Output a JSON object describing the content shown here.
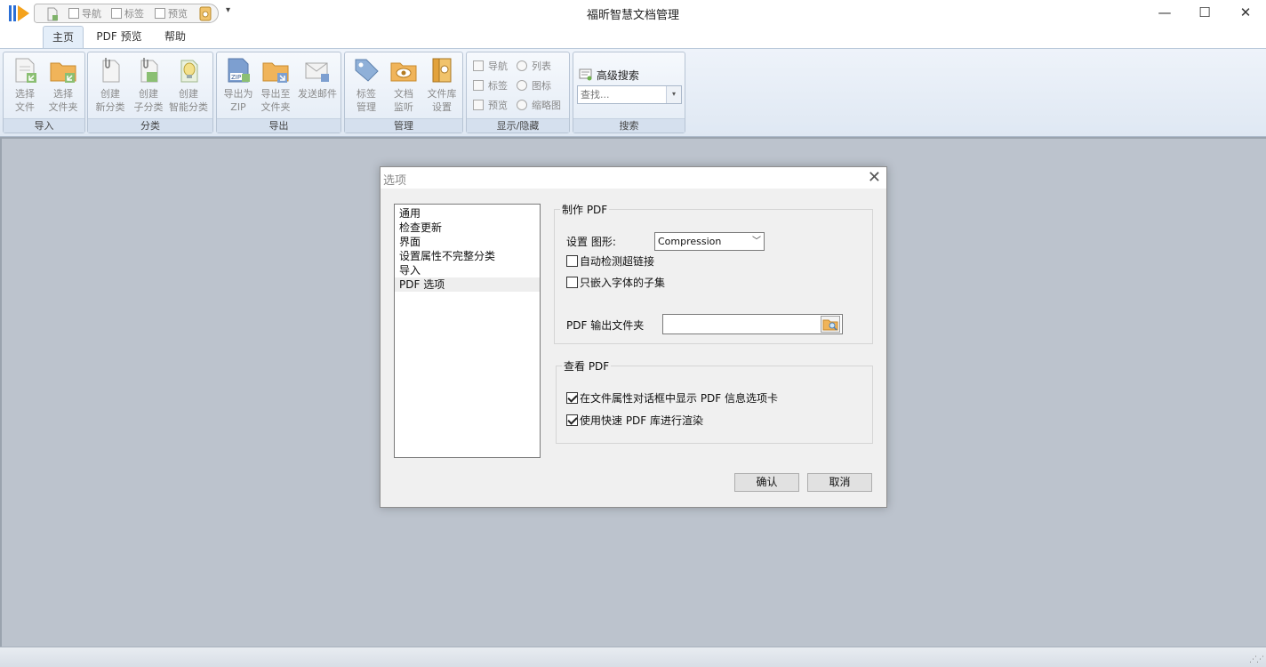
{
  "window": {
    "title": "福昕智慧文档管理",
    "minimize_glyph": "—",
    "maximize_glyph": "☐",
    "close_glyph": "✕"
  },
  "quick_access": {
    "items": [
      "导航",
      "标签",
      "预览"
    ],
    "more_glyph": "▾"
  },
  "tabs": [
    {
      "label": "主页",
      "active": true
    },
    {
      "label": "PDF 预览",
      "active": false
    },
    {
      "label": "帮助",
      "active": false
    }
  ],
  "ribbon": {
    "import": {
      "label": "导入",
      "buttons": [
        {
          "line1": "选择",
          "line2": "文件",
          "icon": "select-file-icon"
        },
        {
          "line1": "选择",
          "line2": "文件夹",
          "icon": "select-folder-icon"
        }
      ]
    },
    "category": {
      "label": "分类",
      "buttons": [
        {
          "line1": "创建",
          "line2": "新分类",
          "icon": "new-category-icon"
        },
        {
          "line1": "创建",
          "line2": "子分类",
          "icon": "sub-category-icon"
        },
        {
          "line1": "创建",
          "line2": "智能分类",
          "icon": "smart-category-icon"
        }
      ]
    },
    "export": {
      "label": "导出",
      "buttons": [
        {
          "line1": "导出为",
          "line2": "ZIP",
          "icon": "zip-icon"
        },
        {
          "line1": "导出至",
          "line2": "文件夹",
          "icon": "export-folder-icon"
        },
        {
          "line1": "发送邮件",
          "line2": "",
          "icon": "mail-icon"
        }
      ]
    },
    "manage": {
      "label": "管理",
      "buttons": [
        {
          "line1": "标签",
          "line2": "管理",
          "icon": "tag-icon"
        },
        {
          "line1": "文档",
          "line2": "监听",
          "icon": "watch-folder-icon"
        },
        {
          "line1": "文件库",
          "line2": "设置",
          "icon": "library-settings-icon"
        }
      ]
    },
    "showhide": {
      "label": "显示/隐藏",
      "checks": [
        "导航",
        "标签",
        "预览"
      ],
      "radios": [
        "列表",
        "图标",
        "缩略图"
      ]
    },
    "search": {
      "label": "搜索",
      "advanced": "高级搜索",
      "placeholder": "查找..."
    }
  },
  "dialog": {
    "title": "选项",
    "close_glyph": "✕",
    "categories": [
      "通用",
      "检查更新",
      "界面",
      "设置属性不完整分类",
      "导入",
      "PDF 选项"
    ],
    "selected_category": 5,
    "make_pdf": {
      "legend": "制作 PDF",
      "image_label": "设置 图形:",
      "image_value": "Compression",
      "auto_detect_links": {
        "label": "自动检测超链接",
        "checked": false
      },
      "embed_subset": {
        "label": "只嵌入字体的子集",
        "checked": false
      },
      "output_folder_label": "PDF 输出文件夹",
      "output_folder_value": ""
    },
    "view_pdf": {
      "legend": "查看 PDF",
      "show_pdf_tab": {
        "label": "在文件属性对话框中显示 PDF 信息选项卡",
        "checked": true
      },
      "fast_render": {
        "label": "使用快速 PDF 库进行渲染",
        "checked": true
      }
    },
    "ok_label": "确认",
    "cancel_label": "取消"
  },
  "colors": {
    "workspace": "#bcc3cd",
    "ribbon": "#e4ecf6",
    "dialog": "#f0f0f0"
  }
}
